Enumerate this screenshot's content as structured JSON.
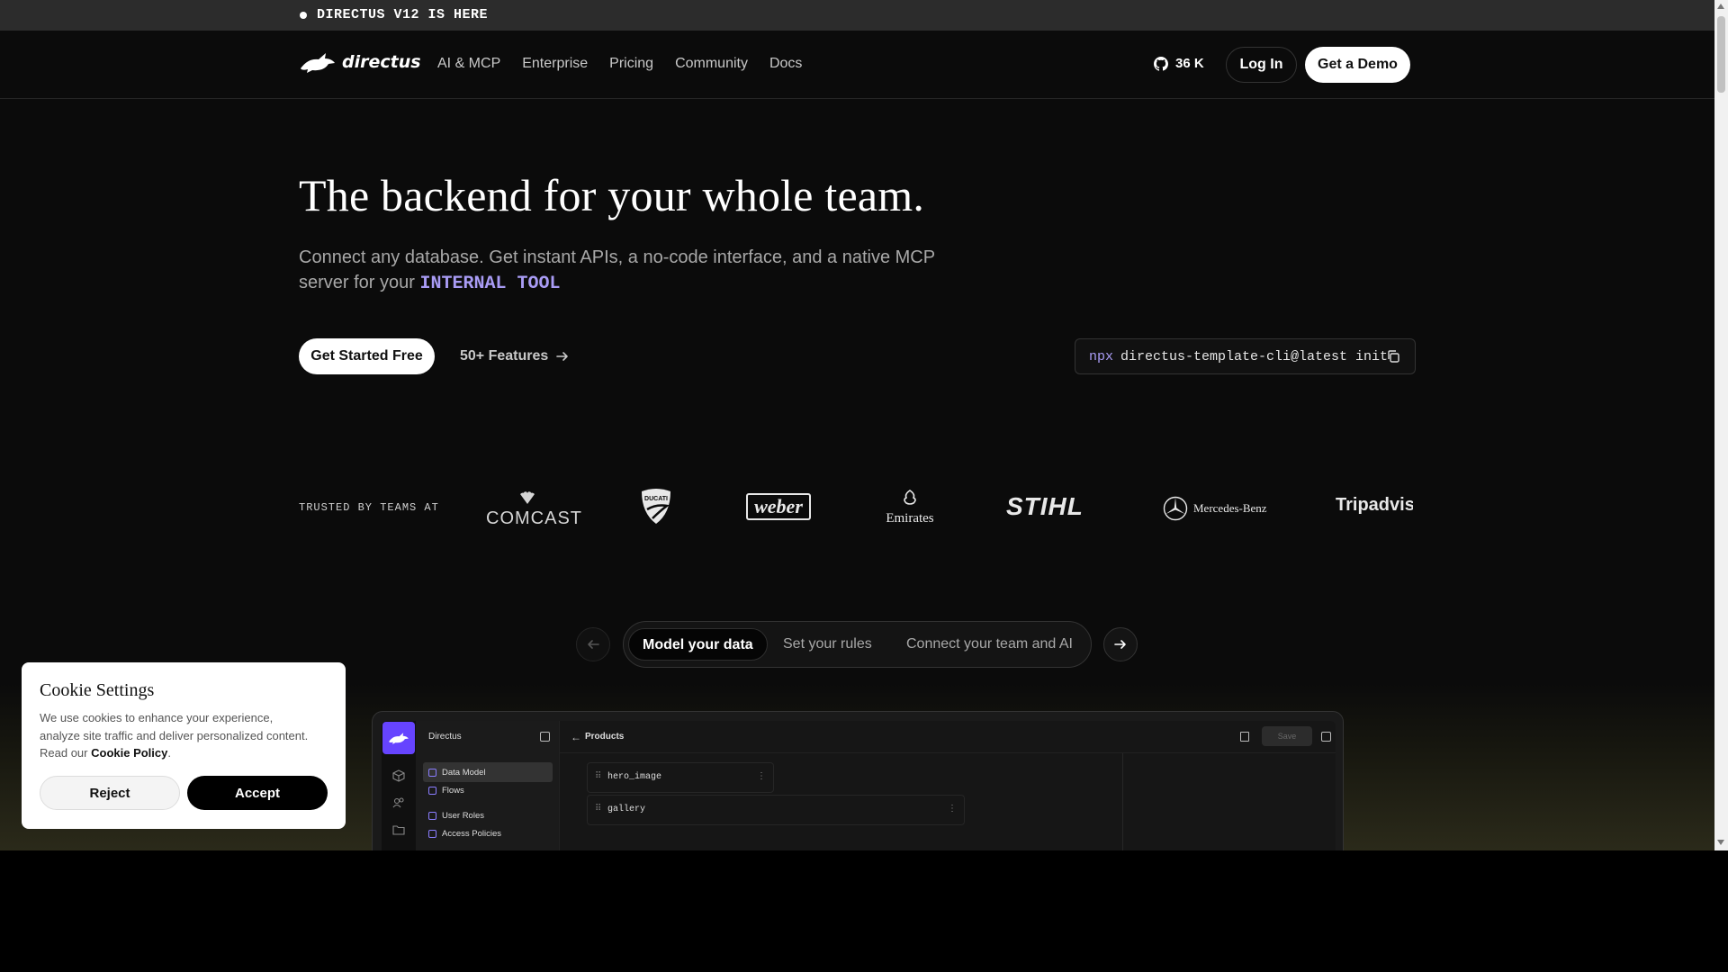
{
  "announcement": {
    "text": "DIRECTUS V12 IS HERE"
  },
  "header": {
    "logo_text": "directus",
    "nav": [
      "AI & MCP",
      "Enterprise",
      "Pricing",
      "Community",
      "Docs"
    ],
    "github_stars": "36 K",
    "login_label": "Log In",
    "demo_label": "Get a Demo"
  },
  "hero": {
    "title": "The backend for your whole team.",
    "subtitle": "Connect any database. Get instant APIs, a no-code interface, and a native MCP server for your",
    "highlight": "INTERNAL TOOL",
    "start_label": "Get Started Free",
    "features_label": "50+ Features",
    "cli_prefix": "npx",
    "cli_command": "directus-template-cli@latest init"
  },
  "trusted": {
    "label": "TRUSTED BY TEAMS AT",
    "brands": [
      "COMCAST",
      "DUCATI",
      "weber",
      "Emirates",
      "STIHL",
      "Mercedes-Benz",
      "Tripadvisor"
    ]
  },
  "tabs": {
    "items": [
      "Model your data",
      "Set your rules",
      "Connect your team and AI"
    ],
    "active": "Model your data"
  },
  "preview": {
    "brand": "Directus",
    "side_items": [
      "Data Model",
      "Flows",
      "User Roles",
      "Access Policies"
    ],
    "page_title": "Products",
    "save_label": "Save",
    "fields": [
      "hero_image",
      "gallery"
    ]
  },
  "cookie": {
    "title": "Cookie Settings",
    "text": "We use cookies to enhance your experience, analyze site traffic and deliver personalized content. Read our",
    "policy_link": "Cookie Policy",
    "reject_label": "Reject",
    "accept_label": "Accept"
  },
  "colors": {
    "accent": "#a99cf5",
    "brand_purple": "#6644ff",
    "background": "#0b0b0b"
  }
}
